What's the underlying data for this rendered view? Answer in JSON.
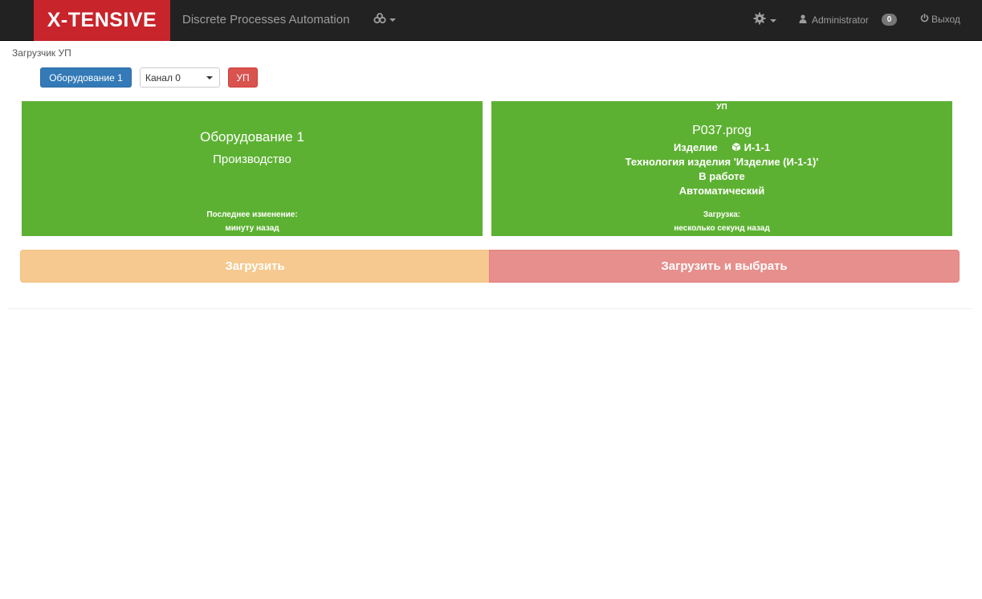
{
  "navbar": {
    "logo": "X-TENSIVE",
    "brand": "Discrete Processes Automation",
    "cogs_icon": "cogs-icon",
    "gear_icon": "gear-icon",
    "user_icon": "user-icon",
    "user_name": "Administrator",
    "badge_count": "0",
    "logout_icon": "power-icon",
    "logout_label": "Выход",
    "accent_color": "#c8242b"
  },
  "breadcrumb": "Загрузчик УП",
  "toolbar": {
    "equipment_button": "Оборудование 1",
    "channel_select": "Канал 0",
    "up_button": "УП"
  },
  "left_panel": {
    "title": "Оборудование 1",
    "subtitle": "Производство",
    "last_change_label": "Последнее изменение:",
    "last_change_value": "минуту назад",
    "color": "#5db132"
  },
  "right_panel": {
    "header": "УП",
    "program": "P037.prog",
    "product_label": "Изделие",
    "product_icon": "cube-icon",
    "product_value": "И-1-1",
    "technology": "Технология изделия 'Изделие (И-1-1)'",
    "status": "В работе",
    "mode": "Автоматический",
    "load_label": "Загрузка:",
    "load_value": "несколько секунд назад"
  },
  "actions": {
    "load": "Загрузить",
    "load_and_select": "Загрузить и выбрать"
  }
}
